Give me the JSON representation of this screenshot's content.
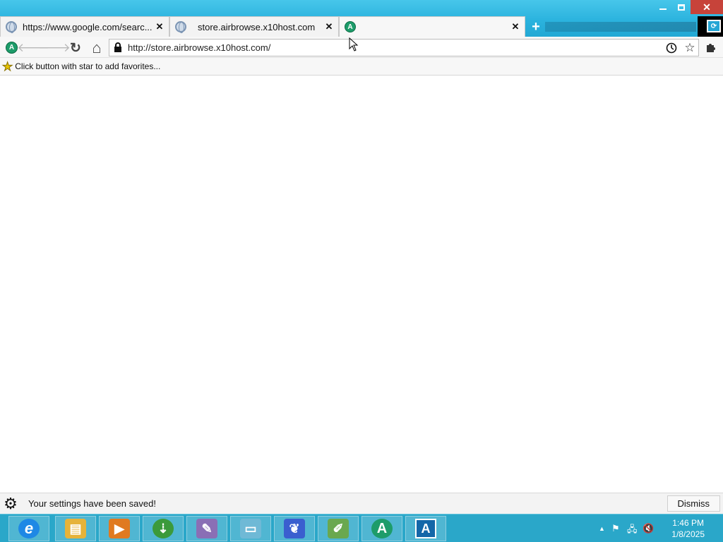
{
  "window": {
    "minimize_glyph": "",
    "restore_glyph": "",
    "close_glyph": "✕"
  },
  "tabs": [
    {
      "title": "https://www.google.com/searc...",
      "favicon": "globe-icon",
      "close": "✕",
      "active": false
    },
    {
      "title": "store.airbrowse.x10host.com",
      "favicon": "globe-icon",
      "close": "✕",
      "active": false
    },
    {
      "title": "",
      "favicon": "airbrowse-logo-icon",
      "close": "✕",
      "active": true
    }
  ],
  "new_tab": "+",
  "toolbar": {
    "app_icon_letter": "A",
    "back": "🡐",
    "forward": "🡒",
    "reload": "↻",
    "home": "⌂",
    "url": "http://store.airbrowse.x10host.com/"
  },
  "bookmarks_bar": {
    "hint": "Click button with star to add favorites..."
  },
  "infobar": {
    "message": "Your settings have been saved!",
    "dismiss_label": "Dismiss"
  },
  "taskbar": {
    "apps": [
      {
        "name": "internet-explorer-icon",
        "glyph": "e",
        "color": "#1e88e5",
        "running": true
      },
      {
        "name": "file-explorer-icon",
        "glyph": "▤",
        "color": "#e6b33a",
        "running": true
      },
      {
        "name": "media-player-icon",
        "glyph": "▶",
        "color": "#e07a20",
        "running": true
      },
      {
        "name": "download-manager-icon",
        "glyph": "⇣",
        "color": "#3b9a3b",
        "running": true
      },
      {
        "name": "paint-icon",
        "glyph": "✎",
        "color": "#8a6fb5",
        "running": true
      },
      {
        "name": "notepad-icon",
        "glyph": "▭",
        "color": "#6fb9d6",
        "running": true
      },
      {
        "name": "feather-app-icon",
        "glyph": "❦",
        "color": "#3a5fcf",
        "running": true
      },
      {
        "name": "notepad-plus-plus-icon",
        "glyph": "✐",
        "color": "#6aa84f",
        "running": true
      },
      {
        "name": "airbrowse-browser-icon",
        "glyph": "A",
        "color": "#1d9c6a",
        "running": true
      },
      {
        "name": "airbrowse-store-icon",
        "glyph": "A",
        "color": "#1467a8",
        "running": true
      }
    ],
    "tray_expand": "▲",
    "tray_flag": "⚑",
    "tray_network": "🖧",
    "tray_volume": "🔇",
    "time": "1:46 PM",
    "date": "1/8/2025"
  }
}
